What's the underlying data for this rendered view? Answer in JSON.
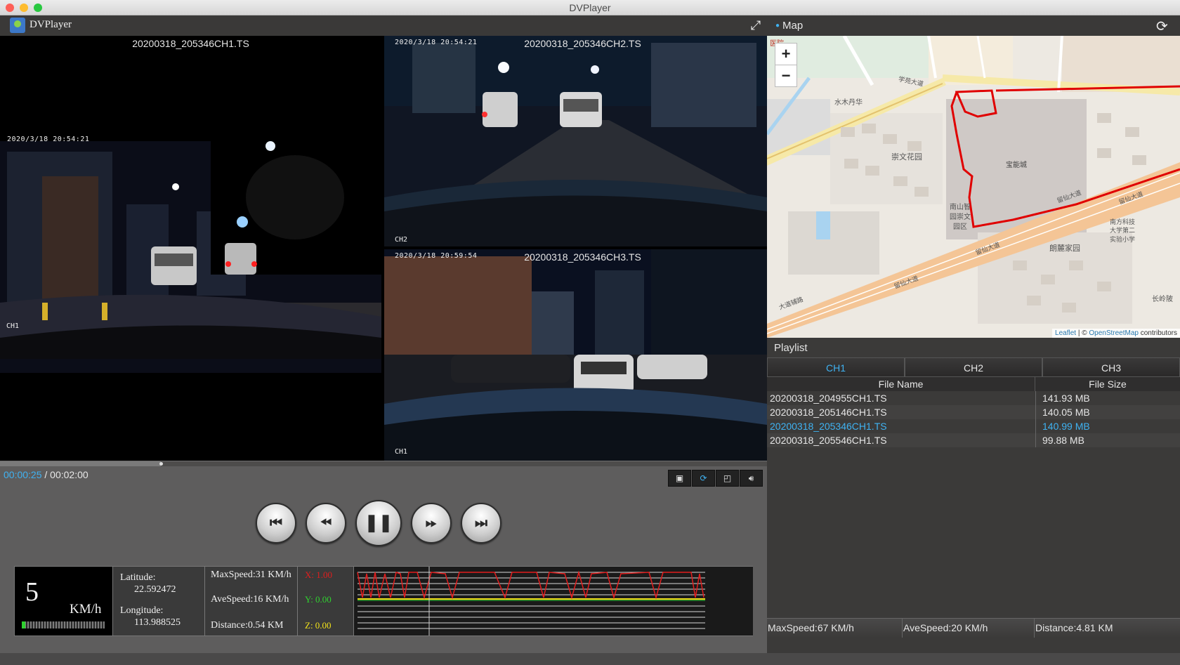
{
  "window": {
    "title": "DVPlayer"
  },
  "app": {
    "name": "DVPlayer"
  },
  "videos": {
    "main": {
      "file": "20200318_205346CH1.TS",
      "stamp": "2020/3/18 20:54:21",
      "channel": "CH1"
    },
    "top_right": {
      "file": "20200318_205346CH2.TS",
      "stamp": "2020/3/18 20:54:21",
      "channel": "CH2"
    },
    "bottom_right": {
      "file": "20200318_205346CH3.TS",
      "stamp": "2020/3/18 20:59:54",
      "channel": "CH1"
    }
  },
  "playback": {
    "current": "00:00:25",
    "separator": " / ",
    "total": "00:02:00",
    "progress": 0.21
  },
  "telemetry": {
    "speed": "5",
    "speed_unit": "KM/h",
    "lat_label": "Latitude:",
    "latitude": "22.592472",
    "lon_label": "Longitude:",
    "longitude": "113.988525",
    "max_speed": "MaxSpeed:31 KM/h",
    "ave_speed": "AveSpeed:16 KM/h",
    "distance": "Distance:0.54 KM",
    "x_axis": "X: 1.00",
    "y_axis": "Y: 0.00",
    "z_axis": "Z: 0.00",
    "colors": {
      "x": "#e21d1d",
      "y": "#2fd12f",
      "z": "#f2e21a"
    }
  },
  "map": {
    "label": "Map",
    "zoom_in": "+",
    "zoom_out": "−",
    "places": {
      "p1": "水木丹华",
      "p2": "崇文花园",
      "p3": "宝能城",
      "p4": "南山智",
      "p5": "园崇文",
      "p6": "园区",
      "p7": "朗麓家园",
      "p8": "南方科技",
      "p9": "大学第二",
      "p10": "实验小学",
      "p11": "长岭陂",
      "r1": "学苑大道",
      "r2": "留仙大道",
      "r3": "留仙大道",
      "r4": "留仙大道",
      "r5": "大道辅路",
      "r6": "留仙大道",
      "r7": "医院"
    },
    "attribution": {
      "leaflet": "Leaflet",
      "sep": " | © ",
      "osm": "OpenStreetMap",
      "suffix": " contributors"
    },
    "route_color": "#e00000"
  },
  "playlist": {
    "title": "Playlist",
    "tabs": [
      "CH1",
      "CH2",
      "CH3"
    ],
    "columns": [
      "File Name",
      "File Size"
    ],
    "rows": [
      {
        "name": "20200318_204955CH1.TS",
        "size": "141.93 MB"
      },
      {
        "name": "20200318_205146CH1.TS",
        "size": "140.05 MB"
      },
      {
        "name": "20200318_205346CH1.TS",
        "size": "140.99 MB"
      },
      {
        "name": "20200318_205546CH1.TS",
        "size": "99.88 MB"
      }
    ]
  },
  "summary": {
    "max_speed": "MaxSpeed:67 KM/h",
    "ave_speed": "AveSpeed:20 KM/h",
    "distance": "Distance:4.81 KM"
  },
  "icons": {
    "fullscreen": "fullscreen-icon",
    "refresh": "refresh-icon",
    "snapshot": "image-icon",
    "sync": "sync-icon",
    "window": "window-icon",
    "volume": "volume-icon",
    "prev": "skip-previous-icon",
    "rewind": "rewind-icon",
    "pause": "pause-icon",
    "forward": "fast-forward-icon",
    "next": "skip-next-icon"
  }
}
